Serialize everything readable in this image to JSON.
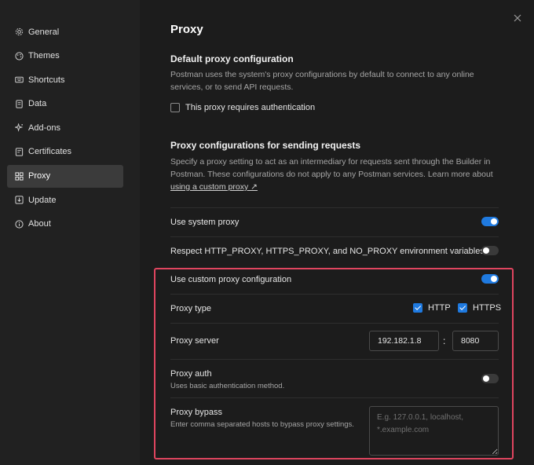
{
  "sidebar": {
    "items": [
      {
        "label": "General",
        "icon": "gear-icon"
      },
      {
        "label": "Themes",
        "icon": "palette-icon"
      },
      {
        "label": "Shortcuts",
        "icon": "keyboard-icon"
      },
      {
        "label": "Data",
        "icon": "data-icon"
      },
      {
        "label": "Add-ons",
        "icon": "sparkle-icon"
      },
      {
        "label": "Certificates",
        "icon": "certificate-icon"
      },
      {
        "label": "Proxy",
        "icon": "proxy-icon",
        "active": true
      },
      {
        "label": "Update",
        "icon": "download-icon"
      },
      {
        "label": "About",
        "icon": "info-icon"
      }
    ]
  },
  "main": {
    "title": "Proxy",
    "default_section": {
      "heading": "Default proxy configuration",
      "description": "Postman uses the system's proxy configurations by default to connect to any online services, or to send API requests.",
      "auth_checkbox_label": "This proxy requires authentication",
      "auth_checked": false
    },
    "requests_section": {
      "heading": "Proxy configurations for sending requests",
      "description": "Specify a proxy setting to act as an intermediary for requests sent through the Builder in Postman. These configurations do not apply to any Postman services. Learn more about",
      "link_text": "using a custom proxy ↗"
    },
    "system_proxy": {
      "label": "Use system proxy",
      "enabled": true
    },
    "env_vars": {
      "label": "Respect HTTP_PROXY, HTTPS_PROXY, and NO_PROXY environment variables",
      "enabled": false
    },
    "custom_proxy": {
      "label": "Use custom proxy configuration",
      "enabled": true
    },
    "proxy_type": {
      "label": "Proxy type",
      "http_label": "HTTP",
      "http_checked": true,
      "https_label": "HTTPS",
      "https_checked": true
    },
    "proxy_server": {
      "label": "Proxy server",
      "host": "192.182.1.8",
      "separator": ":",
      "port": "8080"
    },
    "proxy_auth": {
      "label": "Proxy auth",
      "sublabel": "Uses basic authentication method.",
      "enabled": false
    },
    "proxy_bypass": {
      "label": "Proxy bypass",
      "sublabel": "Enter comma separated hosts to bypass proxy settings.",
      "placeholder": "E.g. 127.0.0.1, localhost, *.example.com"
    }
  },
  "colors": {
    "accent": "#1f7ae0",
    "highlight": "#e0455f",
    "active_item": "#3b3b3b"
  }
}
